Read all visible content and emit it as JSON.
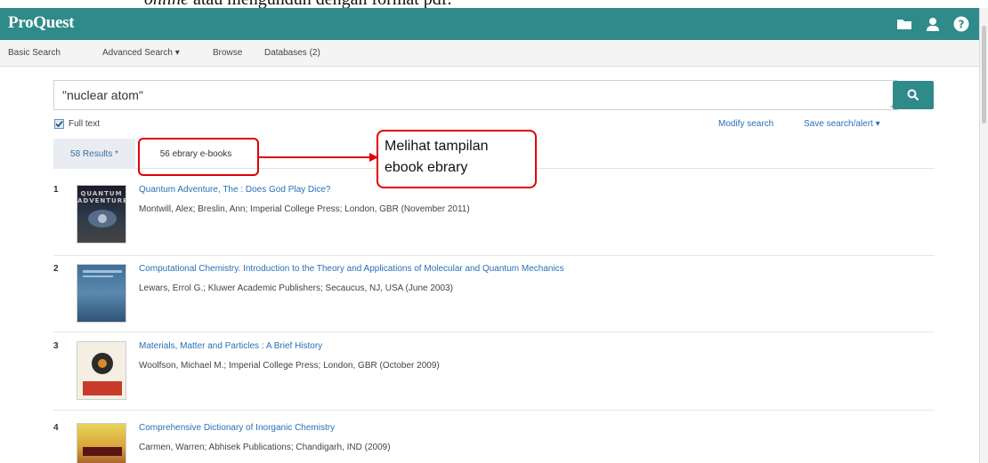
{
  "document": {
    "caption_italic": "online",
    "caption_rest": " atau mengunduh dengan format pdf."
  },
  "header": {
    "logo": "ProQuest",
    "icons": [
      "folder-icon",
      "user-icon",
      "help-icon"
    ],
    "brand_color": "#2f8a8a"
  },
  "subnav": {
    "basic_search": "Basic Search",
    "advanced_search": "Advanced Search ▾",
    "browse": "Browse",
    "databases": "Databases (2)"
  },
  "search": {
    "query": "\"nuclear atom\"",
    "full_text_label": "Full text",
    "full_text_checked": true
  },
  "search_links": {
    "modify": "Modify search",
    "save": "Save search/alert ▾"
  },
  "tabs": {
    "results": "58 Results *",
    "ebooks": "56 ebrary e-books"
  },
  "callout": {
    "line1": "Melihat tampilan",
    "line2": "ebook ebrary",
    "color": "#e00000"
  },
  "results": [
    {
      "num": "1",
      "title": "Quantum Adventure, The : Does God Play Dice?",
      "meta": "Montwill, Alex; Breslin, Ann; Imperial College Press; London, GBR (November 2011)",
      "cover_text": "QUANTUM ADVENTURE"
    },
    {
      "num": "2",
      "title": "Computational Chemistry. Introduction to the Theory and Applications of Molecular and Quantum Mechanics",
      "meta": "Lewars, Errol G.; Kluwer Academic Publishers; Secaucus, NJ, USA (June 2003)",
      "cover_text": ""
    },
    {
      "num": "3",
      "title": "Materials, Matter and Particles : A Brief History",
      "meta": "Woolfson, Michael M.; Imperial College Press; London, GBR (October 2009)",
      "cover_text": ""
    },
    {
      "num": "4",
      "title": "Comprehensive Dictionary of Inorganic Chemistry",
      "meta": "Carmen, Warren; Abhisek Publications; Chandigarh, IND (2009)",
      "cover_text": ""
    }
  ]
}
